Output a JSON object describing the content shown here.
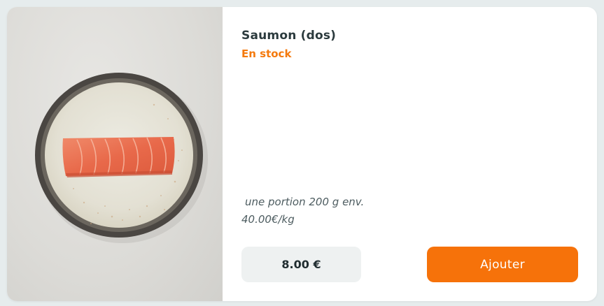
{
  "product": {
    "name": "Saumon (dos)",
    "availability": "En stock",
    "portion": "une portion 200 g env.",
    "price_per_kg": "40.00€/kg",
    "price": "8.00 €",
    "add_button_label": "Ajouter",
    "image_icon": "salmon-fillet-on-plate"
  },
  "colors": {
    "accent": "#f6720a",
    "stock_text": "#f47a0e",
    "title_text": "#2b3a3d",
    "price_bg": "#eef1f1"
  }
}
